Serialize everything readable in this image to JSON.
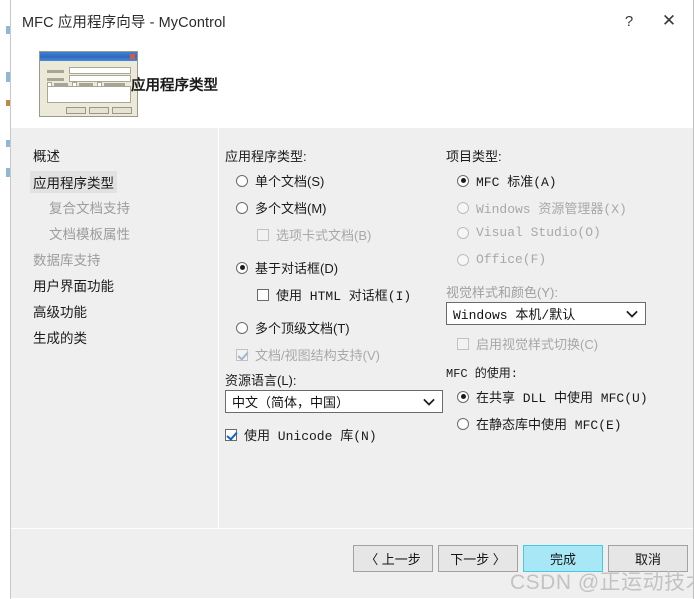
{
  "window": {
    "title": "MFC 应用程序向导 - MyControl",
    "help_glyph": "?",
    "close_glyph": "✕"
  },
  "banner": {
    "title": "应用程序类型"
  },
  "sidebar": {
    "items": [
      {
        "label": "概述",
        "state": "normal",
        "indent": false
      },
      {
        "label": "应用程序类型",
        "state": "selected",
        "indent": false
      },
      {
        "label": "复合文档支持",
        "state": "disabled",
        "indent": true
      },
      {
        "label": "文档模板属性",
        "state": "disabled",
        "indent": true
      },
      {
        "label": "数据库支持",
        "state": "disabled",
        "indent": false
      },
      {
        "label": "用户界面功能",
        "state": "normal",
        "indent": false
      },
      {
        "label": "高级功能",
        "state": "normal",
        "indent": false
      },
      {
        "label": "生成的类",
        "state": "normal",
        "indent": false
      }
    ]
  },
  "app_type": {
    "group_label": "应用程序类型:",
    "options": [
      {
        "label": "单个文档(S)",
        "checked": false,
        "disabled": false
      },
      {
        "label": "多个文档(M)",
        "checked": false,
        "disabled": false
      },
      {
        "label": "基于对话框(D)",
        "checked": true,
        "disabled": false
      },
      {
        "label": "多个顶级文档(T)",
        "checked": false,
        "disabled": false
      }
    ],
    "tabbed_documents": {
      "label": "选项卡式文档(B)",
      "checked": false,
      "disabled": true
    },
    "html_dialog": {
      "label": "使用 HTML 对话框(I)",
      "checked": false,
      "disabled": false
    },
    "doc_view_support": {
      "label": "文档/视图结构支持(V)",
      "checked": true,
      "disabled": true
    },
    "resource_language": {
      "label": "资源语言(L):",
      "value": "中文（简体，中国）"
    },
    "unicode_libs": {
      "label": "使用 Unicode 库(N)",
      "checked": true,
      "disabled": false
    }
  },
  "project_type": {
    "group_label": "项目类型:",
    "options": [
      {
        "label": "MFC 标准(A)",
        "checked": true,
        "disabled": false
      },
      {
        "label": "Windows 资源管理器(X)",
        "checked": false,
        "disabled": true
      },
      {
        "label": "Visual Studio(O)",
        "checked": false,
        "disabled": true
      },
      {
        "label": "Office(F)",
        "checked": false,
        "disabled": true
      }
    ],
    "visual_style": {
      "label": "视觉样式和颜色(Y):",
      "value": "Windows 本机/默认"
    },
    "enable_style_switch": {
      "label": "启用视觉样式切换(C)",
      "checked": false,
      "disabled": true
    },
    "mfc_use": {
      "group_label": "MFC 的使用:",
      "options": [
        {
          "label": "在共享 DLL 中使用 MFC(U)",
          "checked": true,
          "disabled": false
        },
        {
          "label": "在静态库中使用 MFC(E)",
          "checked": false,
          "disabled": false
        }
      ]
    }
  },
  "footer": {
    "back": "〈 上一步",
    "next": "下一步 〉",
    "finish": "完成",
    "cancel": "取消"
  },
  "watermark": "CSDN @正运动技术",
  "colors": {
    "panel_bg": "#efefef",
    "window_bg": "#ffffff",
    "primary_button_fill": "#a8e7f5",
    "primary_button_border": "#46c8e8",
    "disabled_text": "#a0a0a0",
    "selected_nav_bg": "#e2e2e2"
  }
}
